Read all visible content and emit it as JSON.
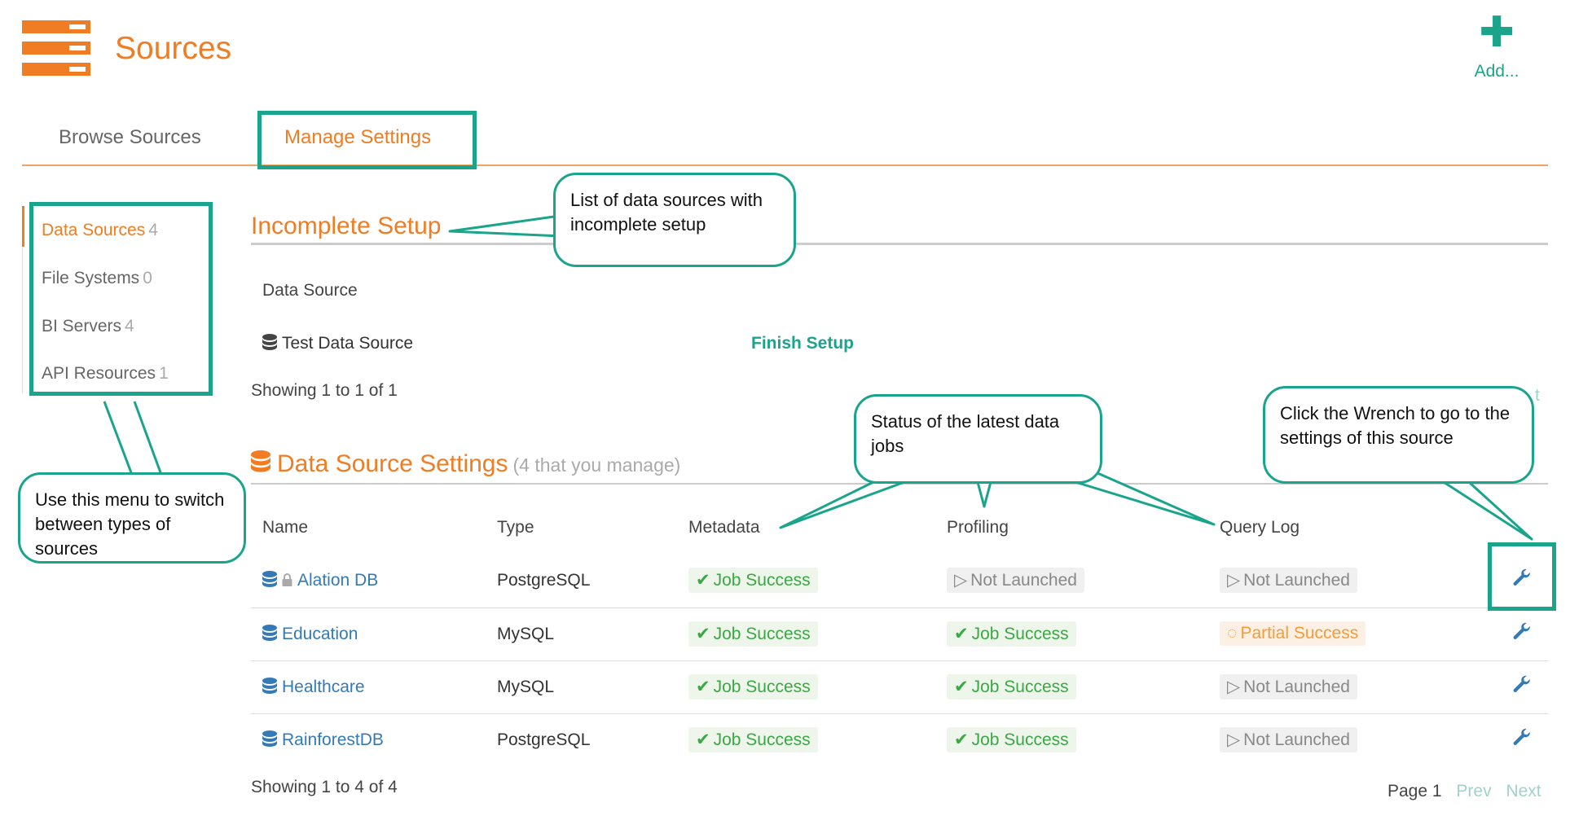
{
  "header": {
    "title": "Sources",
    "add_label": "Add...",
    "add_icon": "plus-icon",
    "logo_icon": "server-rack-icon"
  },
  "tabs": [
    {
      "label": "Browse Sources",
      "active": false
    },
    {
      "label": "Manage Settings",
      "active": true
    }
  ],
  "sidebar": {
    "items": [
      {
        "label": "Data Sources",
        "count": "4",
        "active": true
      },
      {
        "label": "File Systems",
        "count": "0",
        "active": false
      },
      {
        "label": "BI Servers",
        "count": "4",
        "active": false
      },
      {
        "label": "API Resources",
        "count": "1",
        "active": false
      }
    ]
  },
  "incomplete": {
    "title": "Incomplete Setup",
    "column_header": "Data Source",
    "rows": [
      {
        "name": "Test Data Source",
        "action": "Finish Setup"
      }
    ],
    "showing": "Showing 1 to 1 of 1",
    "pager_partial": "t"
  },
  "settings": {
    "title": "Data Source Settings",
    "subtitle": "(4 that you manage)",
    "columns": [
      "Name",
      "Type",
      "Metadata",
      "Profiling",
      "Query Log"
    ],
    "rows": [
      {
        "name": "Alation DB",
        "locked": true,
        "type": "PostgreSQL",
        "metadata": "Job Success",
        "profiling": "Not Launched",
        "query_log": "Not Launched"
      },
      {
        "name": "Education",
        "locked": false,
        "type": "MySQL",
        "metadata": "Job Success",
        "profiling": "Job Success",
        "query_log": "Partial Success"
      },
      {
        "name": "Healthcare",
        "locked": false,
        "type": "MySQL",
        "metadata": "Job Success",
        "profiling": "Job Success",
        "query_log": "Not Launched"
      },
      {
        "name": "RainforestDB",
        "locked": false,
        "type": "PostgreSQL",
        "metadata": "Job Success",
        "profiling": "Job Success",
        "query_log": "Not Launched"
      }
    ],
    "showing": "Showing 1 to 4 of 4",
    "pager": {
      "page": "Page 1",
      "prev": "Prev",
      "next": "Next"
    }
  },
  "callouts": {
    "incomplete": "List of data sources with incomplete setup",
    "menu": "Use this menu to switch between types of sources",
    "status": "Status of the latest data jobs",
    "wrench": "Click the Wrench to go to the settings of this source"
  },
  "colors": {
    "brand_orange": "#f07c23",
    "annotation_teal": "#1aa48c",
    "link_blue": "#337ab7",
    "success_green": "#3aa845",
    "partial_orange": "#f39c3a"
  }
}
